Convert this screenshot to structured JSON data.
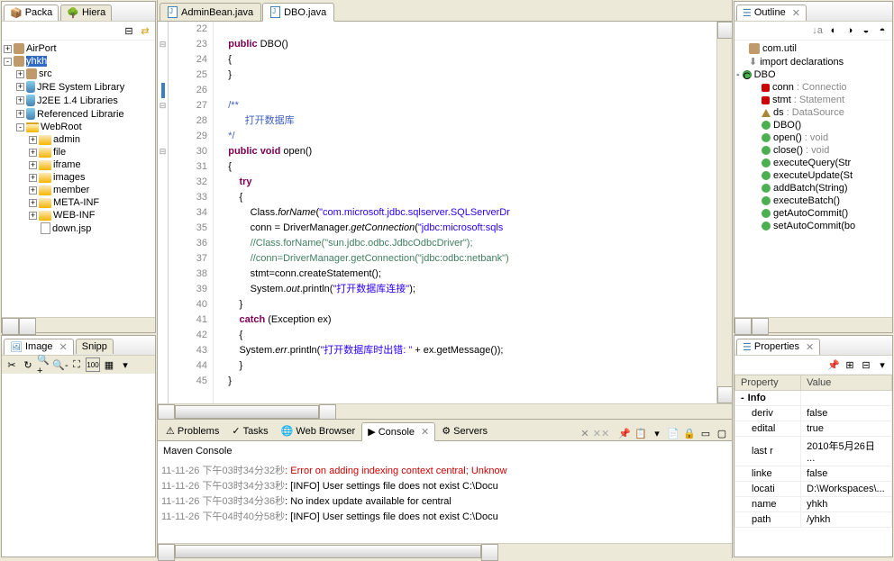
{
  "leftTop": {
    "tabs": [
      "Packa",
      "Hiera"
    ],
    "tree": [
      {
        "indent": 0,
        "exp": "+",
        "icon": "pkg",
        "label": "AirPort"
      },
      {
        "indent": 0,
        "exp": "-",
        "icon": "pkg",
        "label": "yhkh",
        "selected": true
      },
      {
        "indent": 1,
        "exp": "+",
        "icon": "pkg",
        "label": "src"
      },
      {
        "indent": 1,
        "exp": "+",
        "icon": "jar",
        "label": "JRE System Library"
      },
      {
        "indent": 1,
        "exp": "+",
        "icon": "jar",
        "label": "J2EE 1.4 Libraries"
      },
      {
        "indent": 1,
        "exp": "+",
        "icon": "jar",
        "label": "Referenced Librarie"
      },
      {
        "indent": 1,
        "exp": "-",
        "icon": "folder-open",
        "label": "WebRoot"
      },
      {
        "indent": 2,
        "exp": "+",
        "icon": "folder",
        "label": "admin"
      },
      {
        "indent": 2,
        "exp": "+",
        "icon": "folder",
        "label": "file"
      },
      {
        "indent": 2,
        "exp": "+",
        "icon": "folder",
        "label": "iframe"
      },
      {
        "indent": 2,
        "exp": "+",
        "icon": "folder",
        "label": "images"
      },
      {
        "indent": 2,
        "exp": "+",
        "icon": "folder",
        "label": "member"
      },
      {
        "indent": 2,
        "exp": "+",
        "icon": "folder",
        "label": "META-INF"
      },
      {
        "indent": 2,
        "exp": "+",
        "icon": "folder",
        "label": "WEB-INF"
      },
      {
        "indent": 2,
        "exp": "",
        "icon": "file",
        "label": "down.jsp"
      }
    ]
  },
  "leftBottom": {
    "tabs": [
      "Image",
      "Snipp"
    ]
  },
  "editor": {
    "tabs": [
      {
        "label": "AdminBean.java",
        "active": false
      },
      {
        "label": "DBO.java",
        "active": true
      }
    ],
    "startLine": 22,
    "lines": [
      {
        "n": 22,
        "html": ""
      },
      {
        "n": 23,
        "mark": "fold",
        "html": "    <span class='kw'>public</span> DBO()"
      },
      {
        "n": 24,
        "html": "    {"
      },
      {
        "n": 25,
        "html": "    }"
      },
      {
        "n": 26,
        "bar": true,
        "html": ""
      },
      {
        "n": 27,
        "mark": "fold",
        "html": "    <span class='jdoc'>/**</span>"
      },
      {
        "n": 28,
        "html": "    <span class='jdoc'>      打开数据库</span>"
      },
      {
        "n": 29,
        "html": "    <span class='jdoc'>*/</span>"
      },
      {
        "n": 30,
        "mark": "fold",
        "html": "    <span class='kw'>public</span> <span class='kw'>void</span> open()"
      },
      {
        "n": 31,
        "html": "    {"
      },
      {
        "n": 32,
        "html": "        <span class='kw'>try</span>"
      },
      {
        "n": 33,
        "html": "        {"
      },
      {
        "n": 34,
        "html": "            Class.<span class='static-call'>forName</span>(<span class='str'>\"com.microsoft.jdbc.sqlserver.SQLServerDr</span>"
      },
      {
        "n": 35,
        "html": "            conn = DriverManager.<span class='static-call'>getConnection</span>(<span class='str'>\"jdbc:microsoft:sqls</span>"
      },
      {
        "n": 36,
        "html": "            <span class='cmt'>//Class.forName(\"sun.jdbc.odbc.JdbcOdbcDriver\");</span>"
      },
      {
        "n": 37,
        "html": "            <span class='cmt'>//conn=DriverManager.getConnection(\"jdbc:odbc:netbank\")</span>"
      },
      {
        "n": 38,
        "html": "            stmt=conn.createStatement();"
      },
      {
        "n": 39,
        "html": "            System.<span class='static-call'>out</span>.println(<span class='str'>\"打开数据库连接\"</span>);"
      },
      {
        "n": 40,
        "html": "        }"
      },
      {
        "n": 41,
        "html": "        <span class='kw'>catch</span> (Exception ex)"
      },
      {
        "n": 42,
        "html": "        {"
      },
      {
        "n": 43,
        "html": "        System.<span class='static-call'>err</span>.println(<span class='str'>\"打开数据库时出错: \"</span> + ex.getMessage());"
      },
      {
        "n": 44,
        "html": "        }"
      },
      {
        "n": 45,
        "html": "    }"
      }
    ]
  },
  "bottom": {
    "tabs": [
      "Problems",
      "Tasks",
      "Web Browser",
      "Console",
      "Servers"
    ],
    "activeTab": 3,
    "subheader": "Maven Console",
    "lines": [
      {
        "ts": "11-11-26 下午03时34分32秒",
        "cls": "err",
        "text": ": Error on adding indexing context central; Unknow"
      },
      {
        "ts": "11-11-26 下午03时34分33秒",
        "cls": "",
        "text": ": [INFO] User settings file does not exist C:\\Docu"
      },
      {
        "ts": "11-11-26 下午03时34分36秒",
        "cls": "",
        "text": ": No index update available for central"
      },
      {
        "ts": "11-11-26 下午04时40分58秒",
        "cls": "",
        "text": ": [INFO] User settings file does not exist C:\\Docu"
      }
    ]
  },
  "outline": {
    "title": "Outline",
    "items": [
      {
        "indent": 0,
        "icon": "pkg",
        "label": "com.util"
      },
      {
        "indent": 0,
        "icon": "imp",
        "label": "import declarations"
      },
      {
        "indent": 0,
        "icon": "class",
        "label": "DBO",
        "exp": "-"
      },
      {
        "indent": 1,
        "icon": "field",
        "label": "conn",
        "type": ": Connectio"
      },
      {
        "indent": 1,
        "icon": "field",
        "label": "stmt",
        "type": ": Statement"
      },
      {
        "indent": 1,
        "icon": "fieldpub",
        "label": "ds",
        "type": ": DataSource"
      },
      {
        "indent": 1,
        "icon": "ctor",
        "label": "DBO()"
      },
      {
        "indent": 1,
        "icon": "method",
        "label": "open()",
        "type": ": void"
      },
      {
        "indent": 1,
        "icon": "method",
        "label": "close()",
        "type": ": void"
      },
      {
        "indent": 1,
        "icon": "method",
        "label": "executeQuery(Str"
      },
      {
        "indent": 1,
        "icon": "method",
        "label": "executeUpdate(St"
      },
      {
        "indent": 1,
        "icon": "method",
        "label": "addBatch(String)"
      },
      {
        "indent": 1,
        "icon": "method",
        "label": "executeBatch()"
      },
      {
        "indent": 1,
        "icon": "method",
        "label": "getAutoCommit()"
      },
      {
        "indent": 1,
        "icon": "method",
        "label": "setAutoCommit(bo"
      }
    ]
  },
  "properties": {
    "title": "Properties",
    "headers": [
      "Property",
      "Value"
    ],
    "rows": [
      {
        "cat": true,
        "p": "Info",
        "v": ""
      },
      {
        "p": "deriv",
        "v": "false"
      },
      {
        "p": "edital",
        "v": "true"
      },
      {
        "p": "last r",
        "v": "2010年5月26日 ..."
      },
      {
        "p": "linke",
        "v": "false"
      },
      {
        "p": "locati",
        "v": "D:\\Workspaces\\..."
      },
      {
        "p": "name",
        "v": "yhkh"
      },
      {
        "p": "path",
        "v": "/yhkh"
      }
    ]
  }
}
